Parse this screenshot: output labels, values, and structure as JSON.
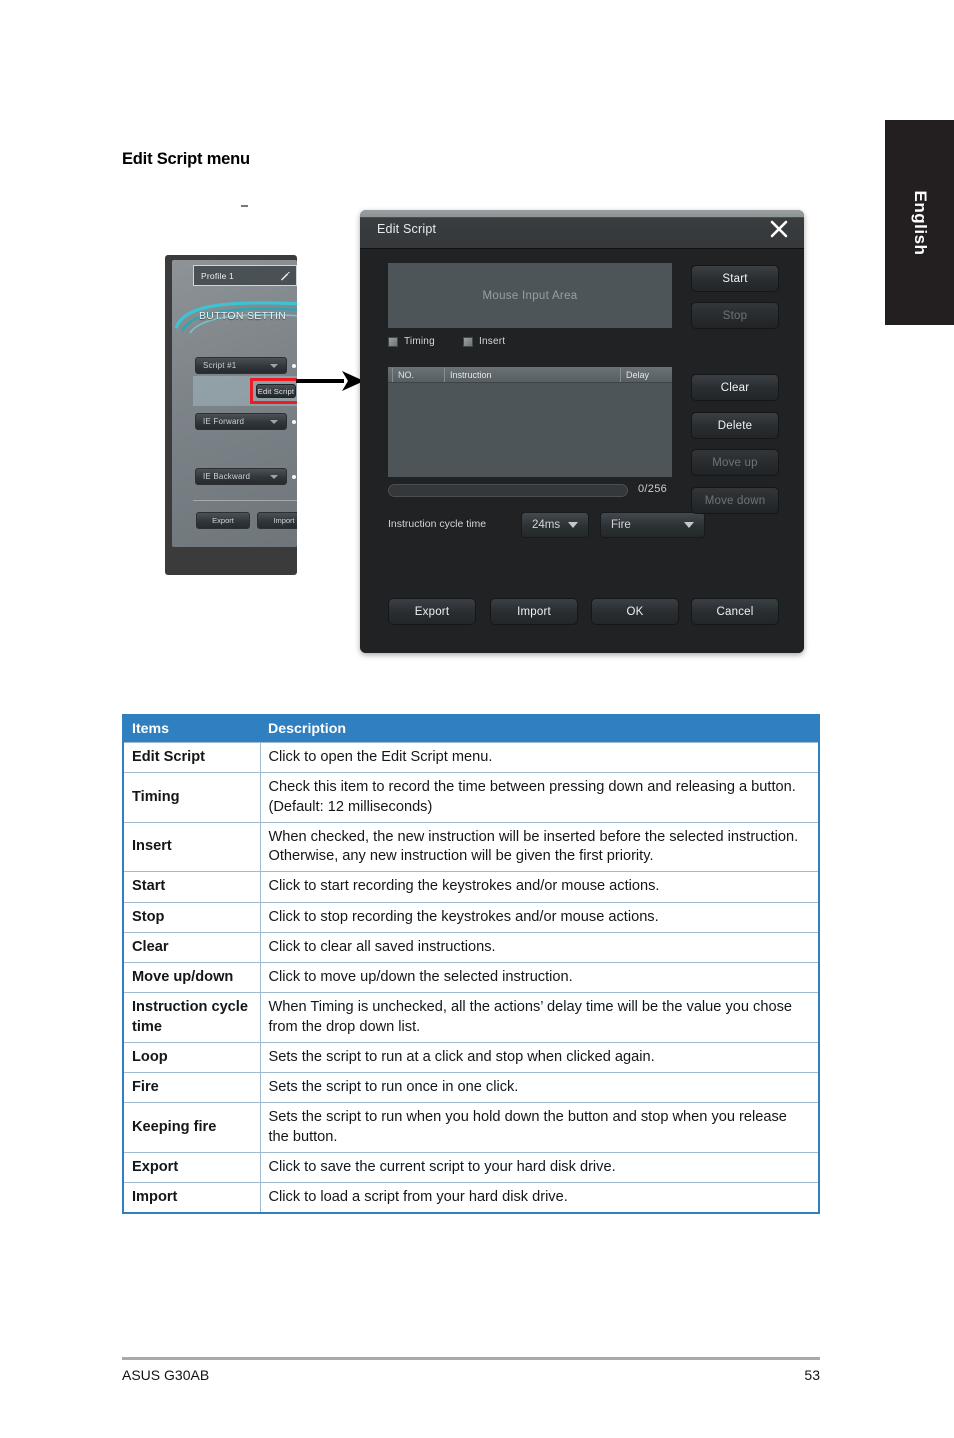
{
  "language_tab": {
    "label": "English"
  },
  "page": {
    "heading": "Edit Script menu",
    "footer_left": "ASUS G30AB",
    "footer_page": "53"
  },
  "left_panel": {
    "profile_label": "Profile 1",
    "pencil_icon": "pencil-icon",
    "section_title": "BUTTON SETTIN",
    "dropdowns": [
      {
        "label": "Script #1"
      },
      {
        "label": "IE Forward"
      },
      {
        "label": "IE Backward"
      }
    ],
    "edit_script_button": "Edit Script",
    "export_button": "Export",
    "import_button": "Import"
  },
  "dialog": {
    "title": "Edit Script",
    "close_icon": "close-icon",
    "mouse_input_area": "Mouse Input Area",
    "checkboxes": [
      {
        "label": "Timing",
        "checked": false
      },
      {
        "label": "Insert",
        "checked": false
      }
    ],
    "list_headers": [
      "NO.",
      "Instruction",
      "Delay"
    ],
    "progress_count": "0/256",
    "cycle_time_label": "Instruction cycle time",
    "cycle_time_value": "24ms",
    "mode_value": "Fire",
    "side_buttons": [
      {
        "label": "Start",
        "enabled": true
      },
      {
        "label": "Stop",
        "enabled": false
      },
      {
        "label": "Clear",
        "enabled": true
      },
      {
        "label": "Delete",
        "enabled": true
      },
      {
        "label": "Move up",
        "enabled": false
      },
      {
        "label": "Move down",
        "enabled": false
      }
    ],
    "footer_buttons": [
      "Export",
      "Import",
      "OK",
      "Cancel"
    ]
  },
  "table": {
    "headers": [
      "Items",
      "Description"
    ],
    "rows": [
      {
        "item": "Edit Script",
        "desc": "Click to open the Edit Script menu."
      },
      {
        "item": "Timing",
        "desc": "Check this item to record the time between pressing down and releasing a button. (Default: 12 milliseconds)"
      },
      {
        "item": "Insert",
        "desc": "When checked, the new instruction will be inserted before the selected instruction. Otherwise, any new instruction will be given the first priority."
      },
      {
        "item": "Start",
        "desc": "Click to start recording the keystrokes and/or mouse actions."
      },
      {
        "item": "Stop",
        "desc": "Click to stop recording the keystrokes and/or mouse actions."
      },
      {
        "item": "Clear",
        "desc": "Click to clear all saved instructions."
      },
      {
        "item": "Move up/down",
        "desc": "Click to move up/down the selected instruction."
      },
      {
        "item": "Instruction cycle time",
        "desc": "When Timing is unchecked, all the actions’ delay time will be the value you chose from the drop down list."
      },
      {
        "item": "Loop",
        "desc": "Sets the script to run at a click and stop when clicked again."
      },
      {
        "item": "Fire",
        "desc": "Sets the script to run once in one click."
      },
      {
        "item": "Keeping fire",
        "desc": "Sets the script to run when you hold down the button and stop when you release the button."
      },
      {
        "item": "Export",
        "desc": "Click to save the current script to your hard disk drive."
      },
      {
        "item": "Import",
        "desc": "Click to load a script from your hard disk drive."
      }
    ]
  },
  "colors": {
    "table_header": "#2f7fc1",
    "table_border": "#2f7fc1",
    "highlight_red": "#ed1c24",
    "tab_black": "#231f20"
  }
}
